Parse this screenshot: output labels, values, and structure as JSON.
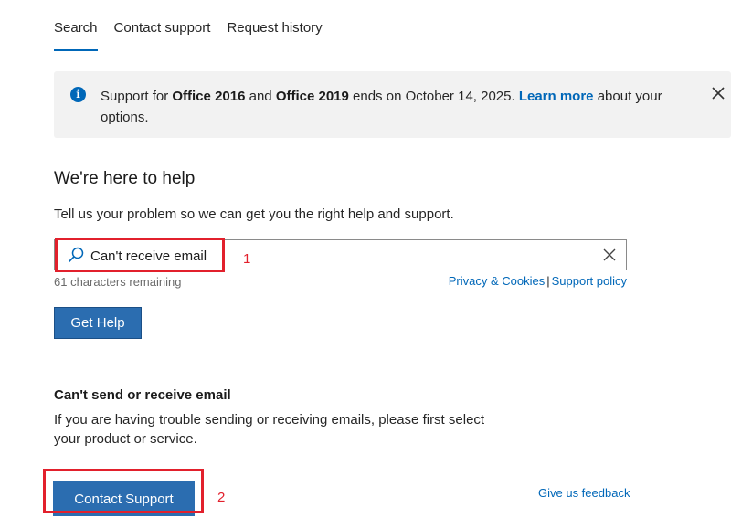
{
  "tabs": [
    {
      "label": "Search",
      "active": true
    },
    {
      "label": "Contact support",
      "active": false
    },
    {
      "label": "Request history",
      "active": false
    }
  ],
  "banner": {
    "icon": "info-icon",
    "text_1": "Support for ",
    "bold_1": "Office 2016",
    "text_2": " and ",
    "bold_2": "Office 2019",
    "text_3": " ends on October 14, 2025. ",
    "link": "Learn more",
    "text_4": " about your options.",
    "close_icon": "close-icon"
  },
  "help": {
    "title": "We're here to help",
    "description": "Tell us your problem so we can get you the right help and support.",
    "search_value": "Can't receive email",
    "chars_remaining": "61 characters remaining",
    "privacy_link": "Privacy & Cookies",
    "separator": "|",
    "support_policy_link": "Support policy",
    "get_help_label": "Get Help"
  },
  "annotations": {
    "marker_1": "1",
    "marker_2": "2",
    "color": "#e2202c"
  },
  "email_section": {
    "title": "Can't send or receive email",
    "description": "If you are having trouble sending or receiving emails, please first select your product or service."
  },
  "footer": {
    "contact_support_label": "Contact Support",
    "feedback_link": "Give us feedback"
  },
  "colors": {
    "accent": "#0067b8",
    "button": "#2b6db0",
    "banner_bg": "#f2f2f2"
  }
}
